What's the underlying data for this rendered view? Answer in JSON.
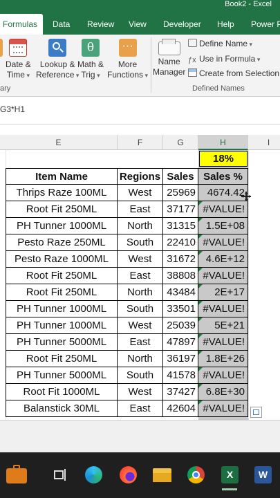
{
  "window": {
    "title": "Book2  -  Excel"
  },
  "tabs": [
    {
      "label": "Formulas",
      "active": true
    },
    {
      "label": "Data"
    },
    {
      "label": "Review"
    },
    {
      "label": "View"
    },
    {
      "label": "Developer"
    },
    {
      "label": "Help"
    },
    {
      "label": "Power P"
    }
  ],
  "ribbon": {
    "function_library": {
      "buttons": [
        {
          "line1": "Date &",
          "line2": "Time"
        },
        {
          "line1": "Lookup &",
          "line2": "Reference"
        },
        {
          "line1": "Math &",
          "line2": "Trig"
        },
        {
          "line1": "More",
          "line2": "Functions"
        }
      ],
      "group_label_fragment": "ary"
    },
    "defined_names": {
      "name_manager": {
        "line1": "Name",
        "line2": "Manager"
      },
      "define_name": "Define Name",
      "use_in_formula": "Use in Formula",
      "create_from_selection": "Create from Selection",
      "group_label": "Defined Names"
    }
  },
  "formula_bar": {
    "text": "G3*H1"
  },
  "columns": [
    "E",
    "F",
    "G",
    "H",
    "I"
  ],
  "percent_cell": "18%",
  "table": {
    "headers": [
      "Item Name",
      "Regions",
      "Sales",
      "Sales %"
    ],
    "rows": [
      [
        "Thrips Raze 100ML",
        "West",
        "25969",
        "4674.42"
      ],
      [
        "Root Fit 250ML",
        "East",
        "37177",
        "#VALUE!"
      ],
      [
        "PH Tunner 1000ML",
        "North",
        "31315",
        "1.5E+08"
      ],
      [
        "Pesto Raze 250ML",
        "South",
        "22410",
        "#VALUE!"
      ],
      [
        "Pesto Raze 1000ML",
        "West",
        "31672",
        "4.6E+12"
      ],
      [
        "Root Fit 250ML",
        "East",
        "38808",
        "#VALUE!"
      ],
      [
        "Root Fit 250ML",
        "North",
        "43484",
        "2E+17"
      ],
      [
        "PH Tunner 1000ML",
        "South",
        "33501",
        "#VALUE!"
      ],
      [
        "PH Tunner 1000ML",
        "West",
        "25039",
        "5E+21"
      ],
      [
        "PH Tunner 5000ML",
        "East",
        "47897",
        "#VALUE!"
      ],
      [
        "Root Fit 250ML",
        "North",
        "36197",
        "1.8E+26"
      ],
      [
        "PH Tunner 5000ML",
        "South",
        "41578",
        "#VALUE!"
      ],
      [
        "Root Fit 1000ML",
        "West",
        "37427",
        "6.8E+30"
      ],
      [
        "Balanstick 30ML",
        "East",
        "42604",
        "#VALUE!"
      ]
    ]
  },
  "taskbar": {
    "icons": [
      "briefcase-icon",
      "task-view-icon",
      "edge-icon",
      "firefox-icon",
      "file-explorer-icon",
      "chrome-icon",
      "excel-icon",
      "word-icon"
    ]
  },
  "colors": {
    "excel_green": "#217346",
    "highlight_yellow": "#ffff00",
    "selected_fill": "#c9c9c9"
  }
}
